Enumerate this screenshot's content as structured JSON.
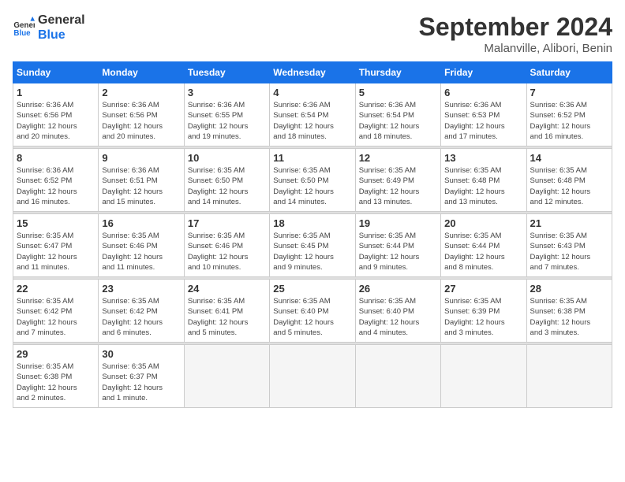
{
  "logo": {
    "text_general": "General",
    "text_blue": "Blue"
  },
  "header": {
    "month": "September 2024",
    "location": "Malanville, Alibori, Benin"
  },
  "weekdays": [
    "Sunday",
    "Monday",
    "Tuesday",
    "Wednesday",
    "Thursday",
    "Friday",
    "Saturday"
  ],
  "weeks": [
    [
      {
        "day": "1",
        "sunrise": "6:36 AM",
        "sunset": "6:56 PM",
        "daylight": "12 hours and 20 minutes."
      },
      {
        "day": "2",
        "sunrise": "6:36 AM",
        "sunset": "6:56 PM",
        "daylight": "12 hours and 20 minutes."
      },
      {
        "day": "3",
        "sunrise": "6:36 AM",
        "sunset": "6:55 PM",
        "daylight": "12 hours and 19 minutes."
      },
      {
        "day": "4",
        "sunrise": "6:36 AM",
        "sunset": "6:54 PM",
        "daylight": "12 hours and 18 minutes."
      },
      {
        "day": "5",
        "sunrise": "6:36 AM",
        "sunset": "6:54 PM",
        "daylight": "12 hours and 18 minutes."
      },
      {
        "day": "6",
        "sunrise": "6:36 AM",
        "sunset": "6:53 PM",
        "daylight": "12 hours and 17 minutes."
      },
      {
        "day": "7",
        "sunrise": "6:36 AM",
        "sunset": "6:52 PM",
        "daylight": "12 hours and 16 minutes."
      }
    ],
    [
      {
        "day": "8",
        "sunrise": "6:36 AM",
        "sunset": "6:52 PM",
        "daylight": "12 hours and 16 minutes."
      },
      {
        "day": "9",
        "sunrise": "6:36 AM",
        "sunset": "6:51 PM",
        "daylight": "12 hours and 15 minutes."
      },
      {
        "day": "10",
        "sunrise": "6:35 AM",
        "sunset": "6:50 PM",
        "daylight": "12 hours and 14 minutes."
      },
      {
        "day": "11",
        "sunrise": "6:35 AM",
        "sunset": "6:50 PM",
        "daylight": "12 hours and 14 minutes."
      },
      {
        "day": "12",
        "sunrise": "6:35 AM",
        "sunset": "6:49 PM",
        "daylight": "12 hours and 13 minutes."
      },
      {
        "day": "13",
        "sunrise": "6:35 AM",
        "sunset": "6:48 PM",
        "daylight": "12 hours and 13 minutes."
      },
      {
        "day": "14",
        "sunrise": "6:35 AM",
        "sunset": "6:48 PM",
        "daylight": "12 hours and 12 minutes."
      }
    ],
    [
      {
        "day": "15",
        "sunrise": "6:35 AM",
        "sunset": "6:47 PM",
        "daylight": "12 hours and 11 minutes."
      },
      {
        "day": "16",
        "sunrise": "6:35 AM",
        "sunset": "6:46 PM",
        "daylight": "12 hours and 11 minutes."
      },
      {
        "day": "17",
        "sunrise": "6:35 AM",
        "sunset": "6:46 PM",
        "daylight": "12 hours and 10 minutes."
      },
      {
        "day": "18",
        "sunrise": "6:35 AM",
        "sunset": "6:45 PM",
        "daylight": "12 hours and 9 minutes."
      },
      {
        "day": "19",
        "sunrise": "6:35 AM",
        "sunset": "6:44 PM",
        "daylight": "12 hours and 9 minutes."
      },
      {
        "day": "20",
        "sunrise": "6:35 AM",
        "sunset": "6:44 PM",
        "daylight": "12 hours and 8 minutes."
      },
      {
        "day": "21",
        "sunrise": "6:35 AM",
        "sunset": "6:43 PM",
        "daylight": "12 hours and 7 minutes."
      }
    ],
    [
      {
        "day": "22",
        "sunrise": "6:35 AM",
        "sunset": "6:42 PM",
        "daylight": "12 hours and 7 minutes."
      },
      {
        "day": "23",
        "sunrise": "6:35 AM",
        "sunset": "6:42 PM",
        "daylight": "12 hours and 6 minutes."
      },
      {
        "day": "24",
        "sunrise": "6:35 AM",
        "sunset": "6:41 PM",
        "daylight": "12 hours and 5 minutes."
      },
      {
        "day": "25",
        "sunrise": "6:35 AM",
        "sunset": "6:40 PM",
        "daylight": "12 hours and 5 minutes."
      },
      {
        "day": "26",
        "sunrise": "6:35 AM",
        "sunset": "6:40 PM",
        "daylight": "12 hours and 4 minutes."
      },
      {
        "day": "27",
        "sunrise": "6:35 AM",
        "sunset": "6:39 PM",
        "daylight": "12 hours and 3 minutes."
      },
      {
        "day": "28",
        "sunrise": "6:35 AM",
        "sunset": "6:38 PM",
        "daylight": "12 hours and 3 minutes."
      }
    ],
    [
      {
        "day": "29",
        "sunrise": "6:35 AM",
        "sunset": "6:38 PM",
        "daylight": "12 hours and 2 minutes."
      },
      {
        "day": "30",
        "sunrise": "6:35 AM",
        "sunset": "6:37 PM",
        "daylight": "12 hours and 1 minute."
      },
      null,
      null,
      null,
      null,
      null
    ]
  ]
}
